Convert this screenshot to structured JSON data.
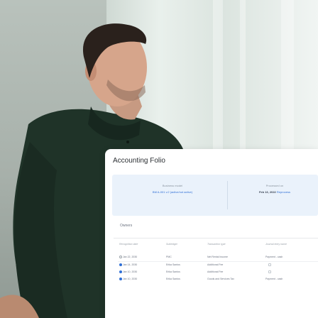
{
  "app": {
    "title": "Accounting Folio"
  },
  "info": {
    "business_model_label": "Business model",
    "business_model_value": "BM A-001 v.2 (active/not active)",
    "processed_label": "Processed on",
    "processed_date": "Feb 13, 2022",
    "reprocess_label": "Reprocess"
  },
  "owners": {
    "label": "Owners"
  },
  "table": {
    "headers": [
      "Recognition date",
      "Subledger",
      "Transaction type",
      "Journal entry name"
    ],
    "rows": [
      {
        "date": "Jan 22, 2030",
        "subledger": "PMC",
        "transaction_type": "Net Rental Income",
        "journal_entry": "Payment - cash"
      },
      {
        "date": "Jan 14, 2030",
        "subledger": "Erika Santos",
        "transaction_type": "Additional Fee",
        "journal_entry": ""
      },
      {
        "date": "Jan 10, 2030",
        "subledger": "Erika Santos",
        "transaction_type": "Additional Fee",
        "journal_entry": ""
      },
      {
        "date": "Jan 10, 2030",
        "subledger": "Erika Santos",
        "transaction_type": "Goods and Services Tax",
        "journal_entry": "Payment - cash"
      }
    ]
  },
  "colors": {
    "accent": "#2f6fd6",
    "panel": "#eaf2fb",
    "shirt": "#1f3328"
  }
}
